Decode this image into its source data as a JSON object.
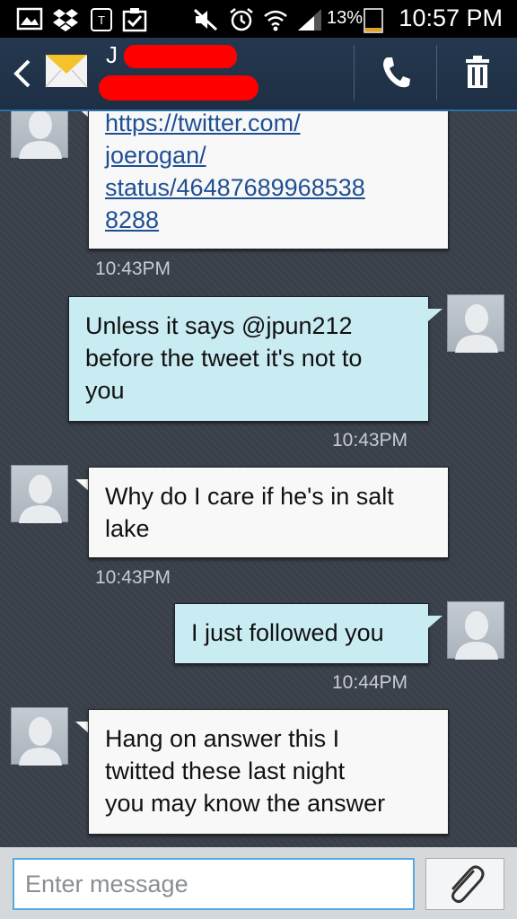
{
  "status_bar": {
    "time": "10:57 PM",
    "battery": "13%",
    "icons": [
      "gallery-icon",
      "dropbox-icon",
      "tmobile-icon",
      "task-icon",
      "mute-icon",
      "alarm-icon",
      "wifi-icon",
      "signal-icon",
      "battery-icon"
    ]
  },
  "header": {
    "contact_initial": "J",
    "contact_name_redacted": true,
    "actions": [
      "back-icon",
      "envelope-icon",
      "phone-icon",
      "trash-icon"
    ]
  },
  "messages": [
    {
      "direction": "in",
      "text": "https://twitter.com/joerogan/status/464876899685388288",
      "lines": [
        "https://twitter.com/",
        "joerogan/",
        "status/46487689968538",
        "8288"
      ],
      "is_link": true,
      "time": "10:43PM"
    },
    {
      "direction": "out",
      "lines": [
        "Unless it says @jpun212",
        "before the tweet it's not to",
        "you"
      ],
      "time": "10:43PM"
    },
    {
      "direction": "in",
      "lines": [
        "Why do I care if he's in salt",
        "lake"
      ],
      "time": "10:43PM"
    },
    {
      "direction": "out",
      "lines": [
        "I just followed you"
      ],
      "time": "10:44PM"
    },
    {
      "direction": "in",
      "lines": [
        "Hang on answer this I",
        "twitted these last night",
        "you may know the answer"
      ],
      "time": ""
    }
  ],
  "compose": {
    "placeholder": "Enter message"
  },
  "colors": {
    "incoming_bubble": "#f8f8f8",
    "outgoing_bubble": "#c9ebf2",
    "background": "#3a4049",
    "header": "#24384f",
    "link": "#1f4f93"
  }
}
